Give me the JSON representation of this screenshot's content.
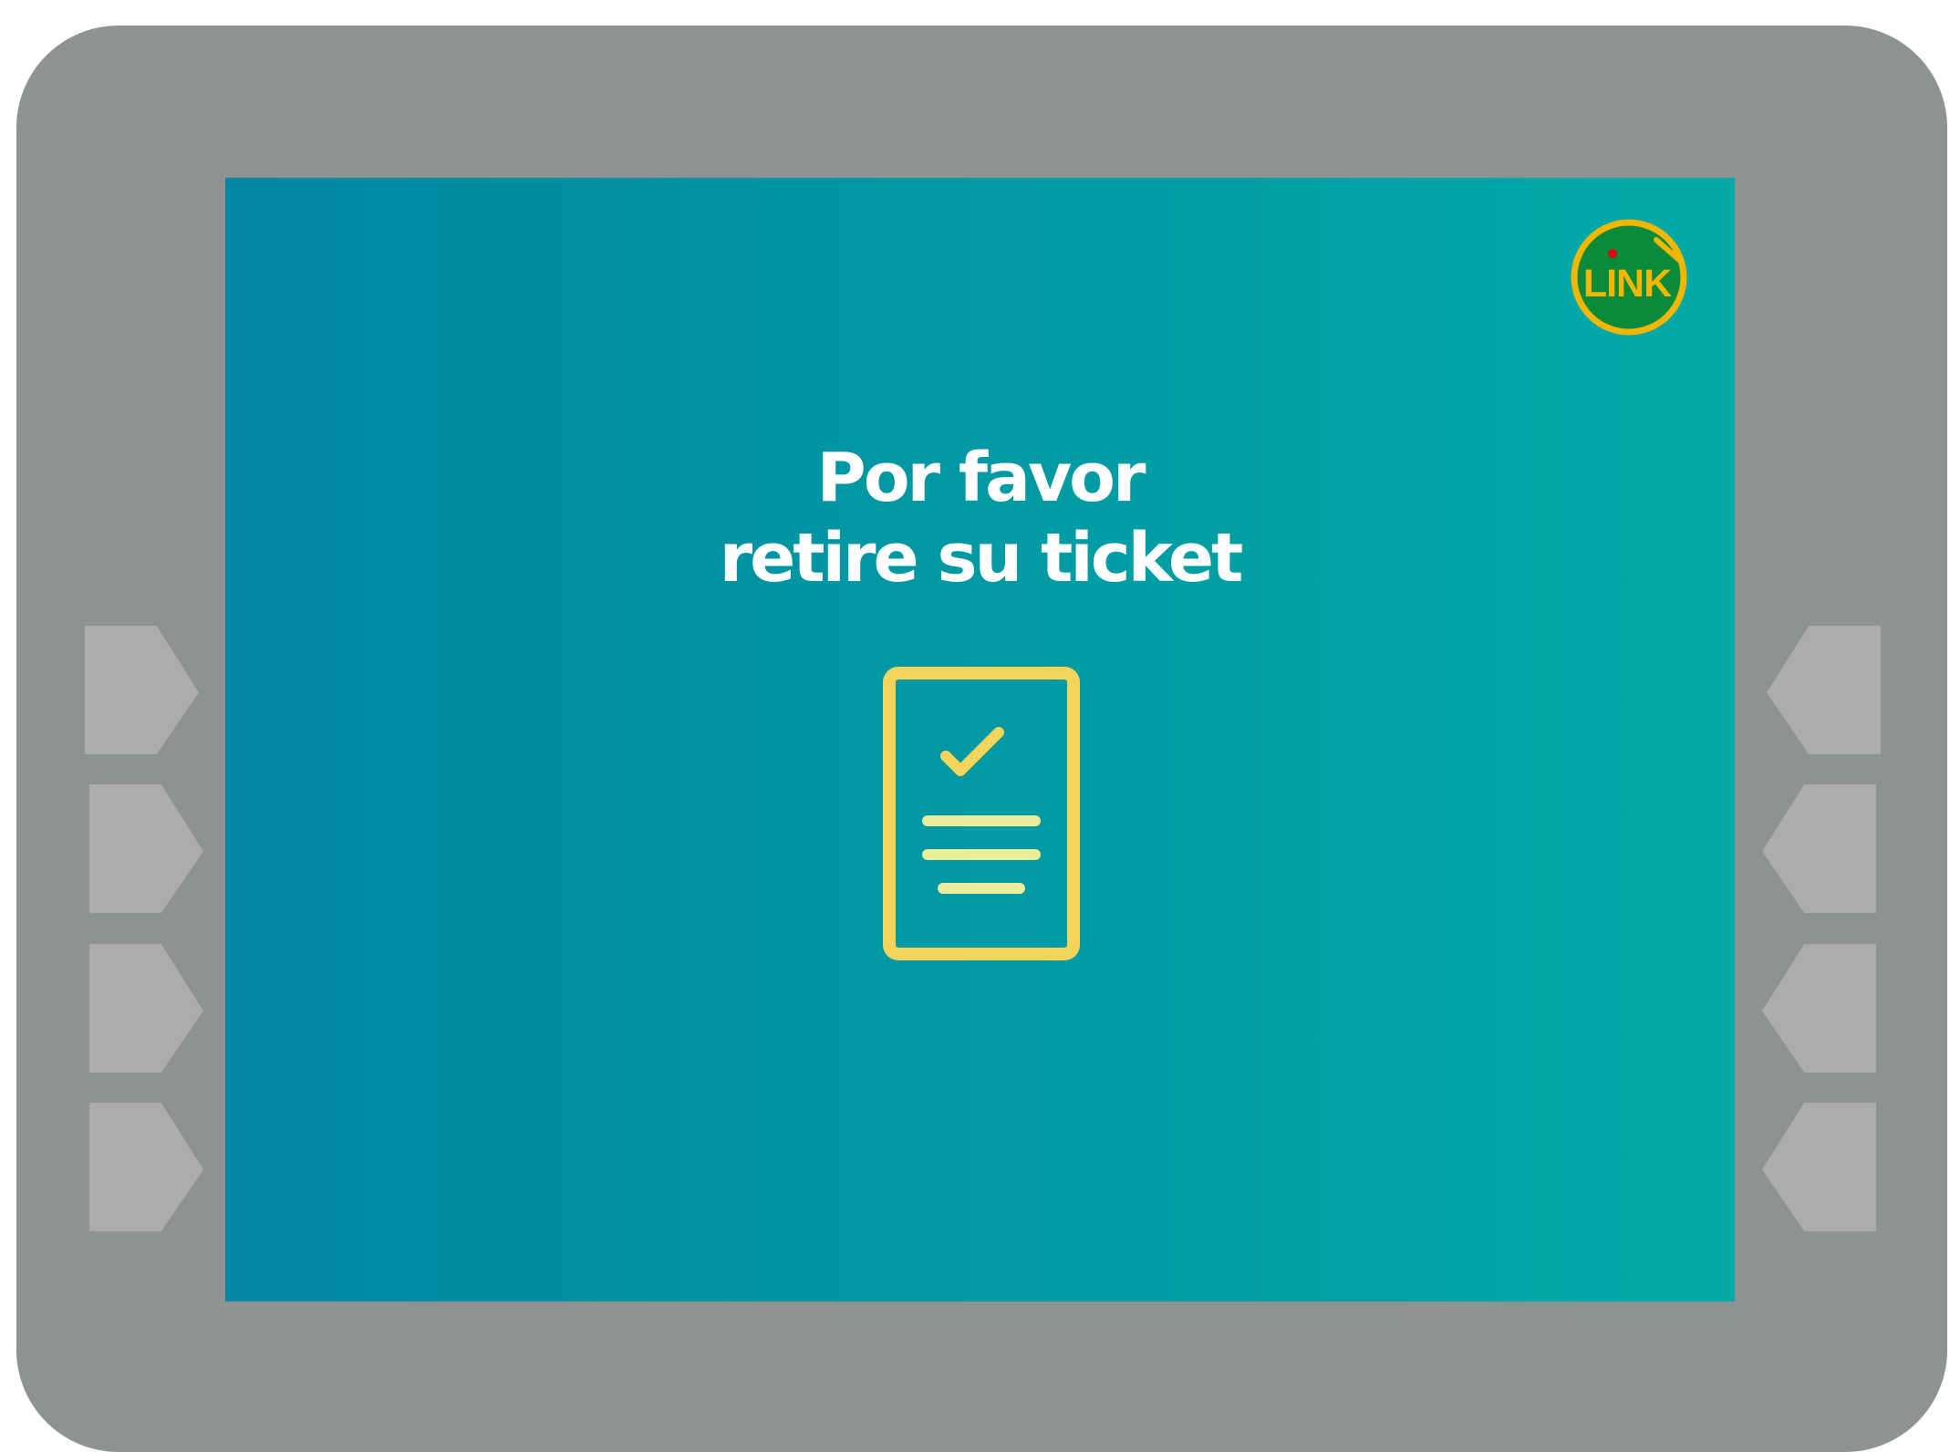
{
  "screen": {
    "message_line1": "Por favor",
    "message_line2": "retire su ticket",
    "gradient_start": "#0286a2",
    "gradient_end": "#01aaa6"
  },
  "logo": {
    "text": "LINK",
    "ring_color": "#f2b705",
    "fill_color": "#0b8a3a",
    "dot_color": "#e30613"
  },
  "icons": {
    "ticket": "receipt-check-icon",
    "stroke_color": "#f3d55b",
    "line_color": "#e9ee9a"
  },
  "keys": {
    "left": [
      "function-key-left-1",
      "function-key-left-2",
      "function-key-left-3",
      "function-key-left-4"
    ],
    "right": [
      "function-key-right-1",
      "function-key-right-2",
      "function-key-right-3",
      "function-key-right-4"
    ],
    "color": "#acacac"
  }
}
